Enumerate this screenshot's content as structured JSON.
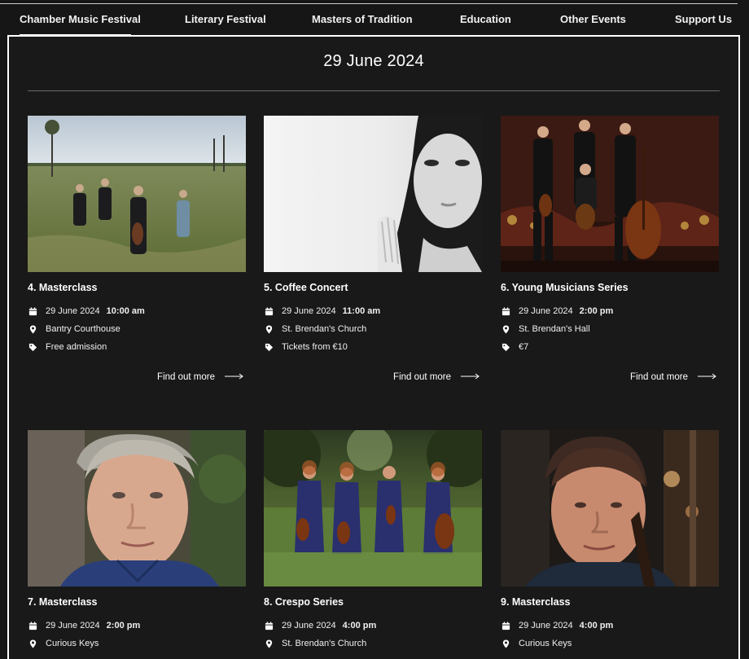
{
  "nav": {
    "items": [
      {
        "label": "Chamber Music Festival",
        "active": true
      },
      {
        "label": "Literary Festival"
      },
      {
        "label": "Masters of Tradition"
      },
      {
        "label": "Education"
      },
      {
        "label": "Other Events"
      },
      {
        "label": "Support Us"
      }
    ]
  },
  "page": {
    "date_heading": "29 June 2024",
    "find_out_more": "Find out more"
  },
  "events": [
    {
      "title": "4. Masterclass",
      "date": "29 June 2024",
      "time": "10:00 am",
      "venue": "Bantry Courthouse",
      "price": "Free admission"
    },
    {
      "title": "5. Coffee Concert",
      "date": "29 June 2024",
      "time": "11:00 am",
      "venue": "St. Brendan's Church",
      "price": "Tickets from €10"
    },
    {
      "title": "6. Young Musicians Series",
      "date": "29 June 2024",
      "time": "2:00 pm",
      "venue": "St. Brendan's Hall",
      "price": "€7"
    },
    {
      "title": "7. Masterclass",
      "date": "29 June 2024",
      "time": "2:00 pm",
      "venue": "Curious Keys"
    },
    {
      "title": "8. Crespo Series",
      "date": "29 June 2024",
      "time": "4:00 pm",
      "venue": "St. Brendan's Church"
    },
    {
      "title": "9. Masterclass",
      "date": "29 June 2024",
      "time": "4:00 pm",
      "venue": "Curious Keys"
    }
  ],
  "icons": {
    "calendar": "calendar-icon",
    "location": "location-pin-icon",
    "price": "price-tag-icon",
    "arrow": "arrow-right-icon"
  },
  "colors": {
    "background": "#191919",
    "text": "#ffffff",
    "frame": "#ffffff"
  }
}
